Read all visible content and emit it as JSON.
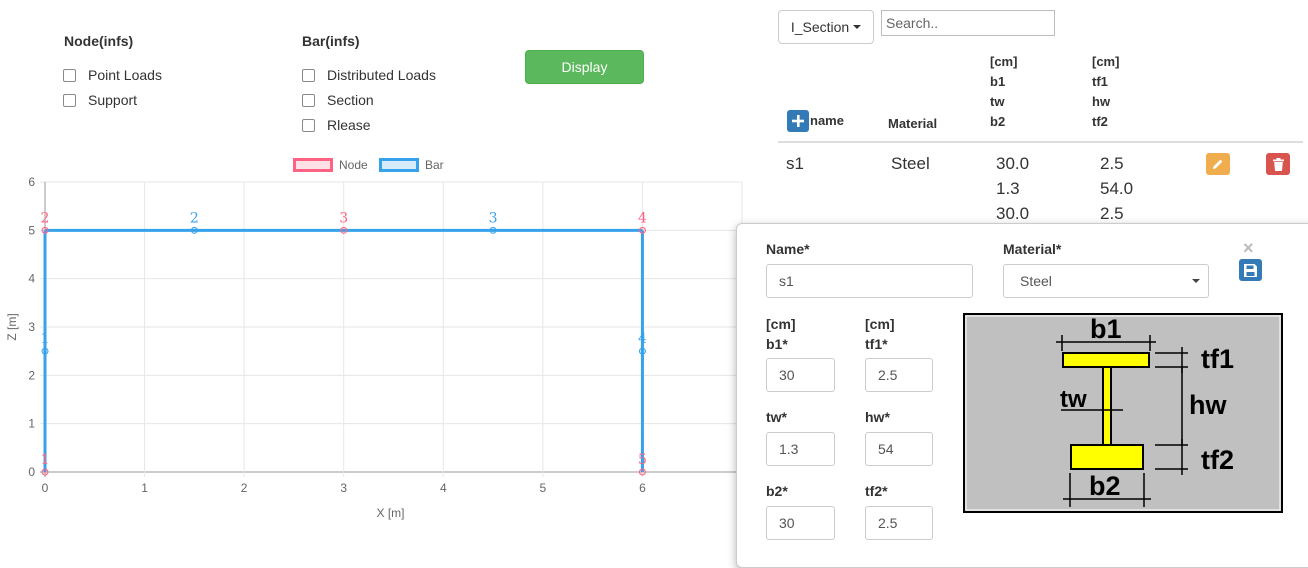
{
  "filters": {
    "node_title": "Node(infs)",
    "node_options": [
      "Point Loads",
      "Support"
    ],
    "bar_title": "Bar(infs)",
    "bar_options": [
      "Distributed Loads",
      "Section",
      "Rlease"
    ],
    "display_label": "Display"
  },
  "legend": {
    "node_label": "Node",
    "bar_label": "Bar",
    "node_color": "#ff6384",
    "bar_color": "#36a2eb"
  },
  "chart_data": {
    "type": "scatter",
    "title": "",
    "xlabel": "X [m]",
    "ylabel": "Z [m]",
    "xlim": [
      0,
      7
    ],
    "ylim": [
      0,
      6
    ],
    "x_ticks": [
      "0",
      "1",
      "2",
      "3",
      "4",
      "5",
      "6"
    ],
    "y_ticks": [
      "0",
      "1",
      "2",
      "3",
      "4",
      "5",
      "6"
    ],
    "grid": true,
    "series": [
      {
        "name": "Node",
        "color": "#ff6384",
        "points": [
          {
            "x": 0,
            "y": 0,
            "label": "1"
          },
          {
            "x": 0,
            "y": 5,
            "label": "2"
          },
          {
            "x": 3,
            "y": 5,
            "label": "3"
          },
          {
            "x": 6,
            "y": 5,
            "label": "4"
          },
          {
            "x": 6,
            "y": 0,
            "label": "5"
          }
        ]
      },
      {
        "name": "Bar",
        "color": "#36a2eb",
        "lines": [
          {
            "from": [
              0,
              0
            ],
            "to": [
              0,
              5
            ]
          },
          {
            "from": [
              0,
              5
            ],
            "to": [
              6,
              5
            ]
          },
          {
            "from": [
              6,
              5
            ],
            "to": [
              6,
              0
            ]
          }
        ],
        "points": [
          {
            "x": 0,
            "y": 2.5,
            "label": "1"
          },
          {
            "x": 1.5,
            "y": 5,
            "label": "2"
          },
          {
            "x": 4.5,
            "y": 5,
            "label": "3"
          },
          {
            "x": 6,
            "y": 2.5,
            "label": "4"
          }
        ]
      }
    ]
  },
  "section_table": {
    "type_dropdown": "I_Section",
    "search_placeholder": "Search..",
    "headers": {
      "name": "name",
      "material": "Material",
      "col3": [
        "[cm]",
        "b1",
        "tw",
        "b2"
      ],
      "col4": [
        "[cm]",
        "tf1",
        "hw",
        "tf2"
      ]
    },
    "rows": [
      {
        "name": "s1",
        "material": "Steel",
        "col3": [
          "30.0",
          "1.3",
          "30.0"
        ],
        "col4": [
          "2.5",
          "54.0",
          "2.5"
        ]
      }
    ],
    "edit_color": "#f0ad4e",
    "delete_color": "#d9534f",
    "add_color": "#337ab7"
  },
  "edit_form": {
    "name_label": "Name*",
    "name_value": "s1",
    "material_label": "Material*",
    "material_value": "Steel",
    "unit": "[cm]",
    "b1_label": "b1*",
    "b1_value": "30",
    "tf1_label": "tf1*",
    "tf1_value": "2.5",
    "tw_label": "tw*",
    "tw_value": "1.3",
    "hw_label": "hw*",
    "hw_value": "54",
    "b2_label": "b2*",
    "b2_value": "30",
    "tf2_label": "tf2*",
    "tf2_value": "2.5",
    "close_glyph": "×"
  },
  "section_diagram": {
    "labels": {
      "b1": "b1",
      "tf1": "tf1",
      "tw": "tw",
      "hw": "hw",
      "b2": "b2",
      "tf2": "tf2"
    }
  }
}
